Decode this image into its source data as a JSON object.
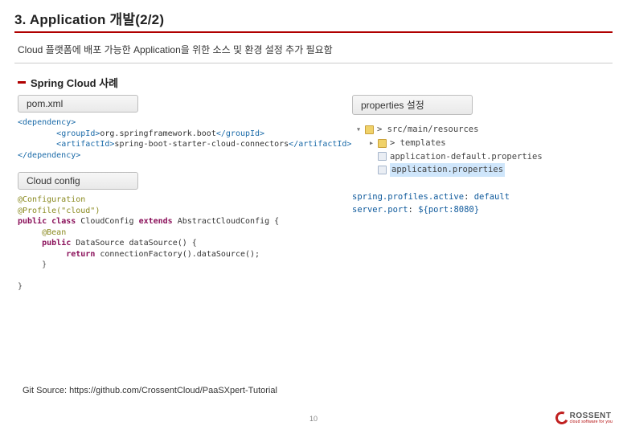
{
  "page": {
    "title": "3. Application 개발(2/2)",
    "description": "Cloud 플랫폼에 배포 가능한 Application을 위한 소스 및 환경 설정 추가 필요함",
    "section_title": "Spring Cloud 사례",
    "page_number": "10"
  },
  "labels": {
    "pom": "pom.xml",
    "cloud_config": "Cloud config",
    "properties": "properties 설정"
  },
  "pom_code": {
    "open_dep": "<dependency>",
    "group_open": "<groupId>",
    "group_val": "org.springframework.boot",
    "group_close": "</groupId>",
    "artifact_open": "<artifactId>",
    "artifact_val": "spring-boot-starter-cloud-connectors",
    "artifact_close": "</artifactId>",
    "close_dep": "</dependency>"
  },
  "cloud_config_code": {
    "anno_config": "@Configuration",
    "anno_profile": "@Profile(\"cloud\")",
    "kw_public": "public",
    "kw_class": "class",
    "cls_name": "CloudConfig",
    "kw_extends": "extends",
    "ext_name": "AbstractCloudConfig {",
    "anno_bean": "@Bean",
    "ret_type": "DataSource",
    "method_sig": "dataSource() {",
    "kw_return": "return",
    "return_expr": "connectionFactory().dataSource();",
    "brace": "}",
    "brace2": "}"
  },
  "tree": {
    "root_caret": "▾",
    "root": "src/main/resources",
    "templates_caret": "▸",
    "templates": "templates",
    "app_default": "application-default.properties",
    "app_props": "application.properties"
  },
  "props": {
    "k1": "spring.profiles.active",
    "v1": "default",
    "k2": "server.port",
    "v2": "${port:8080}"
  },
  "footer": {
    "git_label": "Git Source: https://github.com/CrossentCloud/PaaSXpert-Tutorial"
  },
  "brand": {
    "name": "ROSSENT",
    "tagline": "cloud software for you"
  }
}
